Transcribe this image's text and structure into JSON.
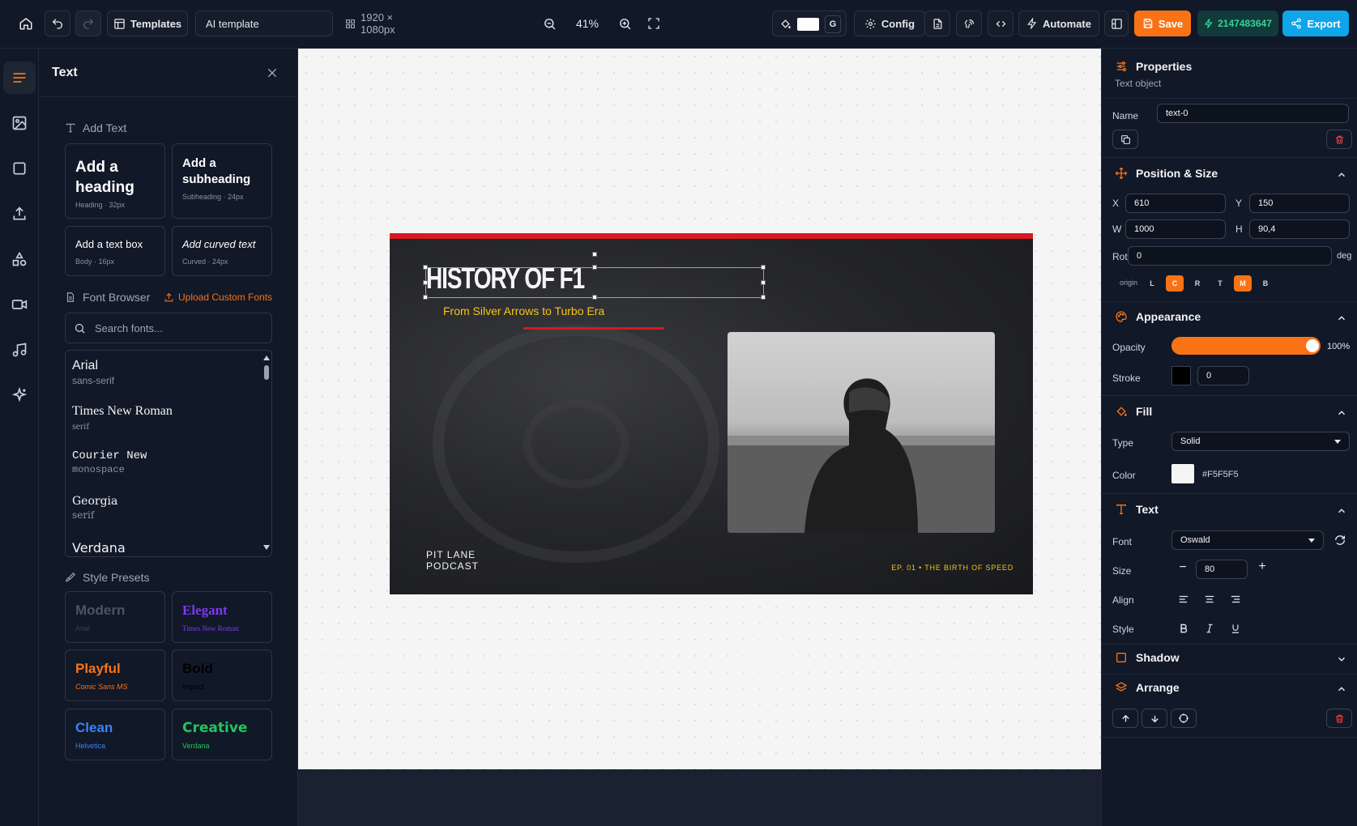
{
  "toolbar": {
    "templates_label": "Templates",
    "template_name": "AI template",
    "canvas_size": "1920 × 1080px",
    "zoom": "41%",
    "color_letter": "G",
    "config_label": "Config",
    "automate_label": "Automate",
    "save_label": "Save",
    "credits": "2147483647",
    "export_label": "Export"
  },
  "left_panel": {
    "title": "Text",
    "add_text_label": "Add Text",
    "cards": [
      {
        "main": "Add a heading",
        "sub": "Heading · 32px"
      },
      {
        "main": "Add a subheading",
        "sub": "Subheading · 24px"
      },
      {
        "main": "Add a text box",
        "sub": "Body · 16px"
      },
      {
        "main": "Add curved text",
        "sub": "Curved · 24px"
      }
    ],
    "font_browser_label": "Font Browser",
    "upload_label": "Upload Custom Fonts",
    "search_placeholder": "Search fonts...",
    "fonts": [
      {
        "name": "Arial",
        "category": "sans-serif"
      },
      {
        "name": "Times New Roman",
        "category": "serif"
      },
      {
        "name": "Courier New",
        "category": "monospace"
      },
      {
        "name": "Georgia",
        "category": "serif"
      },
      {
        "name": "Verdana",
        "category": ""
      }
    ],
    "presets_label": "Style Presets",
    "presets": [
      {
        "name": "Modern",
        "font": "Arial",
        "color": "#4b5563"
      },
      {
        "name": "Elegant",
        "font": "Times New Roman",
        "color": "#7c3aed"
      },
      {
        "name": "Playful",
        "font": "Comic Sans MS",
        "color": "#f97316"
      },
      {
        "name": "Bold",
        "font": "Impact",
        "color": "#000000"
      },
      {
        "name": "Clean",
        "font": "Helvetica",
        "color": "#3b82f6"
      },
      {
        "name": "Creative",
        "font": "Verdana",
        "color": "#22c55e"
      }
    ]
  },
  "slide": {
    "title": "HISTORY OF F1",
    "subtitle": "From Silver Arrows to Turbo Era",
    "podcast_line1": "PIT LANE",
    "podcast_line2": "PODCAST",
    "episode": "EP. 01 • THE BIRTH OF SPEED"
  },
  "properties": {
    "title": "Properties",
    "subtitle": "Text object",
    "name_label": "Name",
    "name_value": "text-0",
    "position_title": "Position & Size",
    "x_label": "X",
    "x_value": "610",
    "y_label": "Y",
    "y_value": "150",
    "w_label": "W",
    "w_value": "1000",
    "h_label": "H",
    "h_value": "90,4",
    "rot_label": "Rot",
    "rot_value": "0",
    "rot_unit": "deg",
    "origin_label": "origin",
    "origin_h": [
      "L",
      "C",
      "R"
    ],
    "origin_v": [
      "T",
      "M",
      "B"
    ],
    "appearance_title": "Appearance",
    "opacity_label": "Opacity",
    "opacity_value": "100%",
    "opacity_fraction": 1.0,
    "stroke_label": "Stroke",
    "stroke_value": "0",
    "stroke_color": "#000000",
    "fill_title": "Fill",
    "type_label": "Type",
    "type_value": "Solid",
    "color_label": "Color",
    "color_value": "#F5F5F5",
    "text_title": "Text",
    "font_label": "Font",
    "font_value": "Oswald",
    "size_label": "Size",
    "size_value": "80",
    "align_label": "Align",
    "style_label": "Style",
    "shadow_title": "Shadow",
    "arrange_title": "Arrange"
  },
  "colors": {
    "accent": "#f97316",
    "export_blue": "#0ea5e9",
    "credits_green": "#34d399",
    "slide_red": "#d71920",
    "slide_yellow": "#f5c518"
  }
}
